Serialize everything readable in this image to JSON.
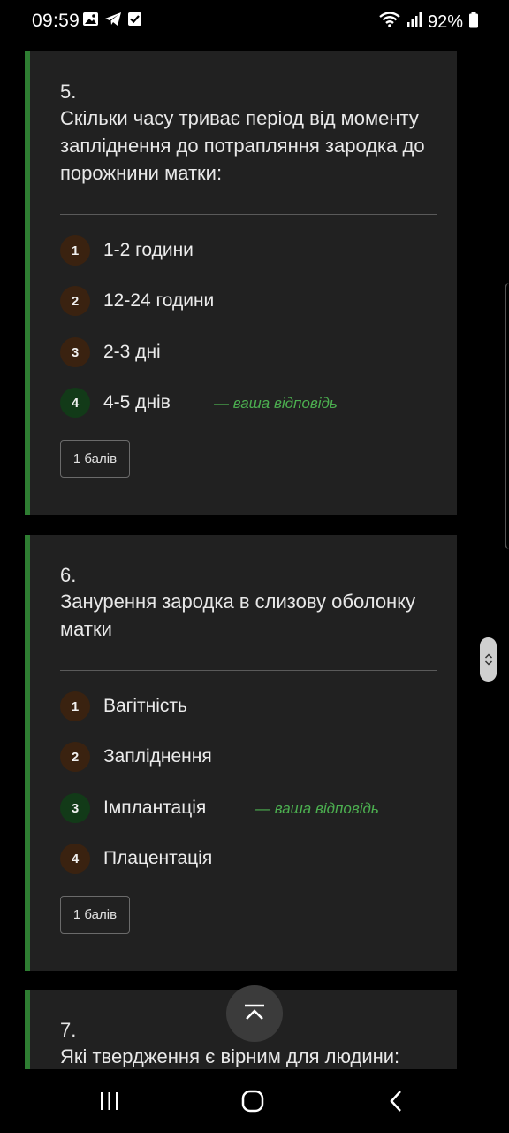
{
  "status_bar": {
    "time": "09:59",
    "battery": "92%",
    "icons_left": [
      "image-icon",
      "telegram-icon",
      "checkbox-icon"
    ],
    "icons_right": [
      "wifi-icon",
      "signal-icon",
      "battery-icon"
    ]
  },
  "questions": [
    {
      "number": "5.",
      "text": "Скільки часу триває період від моменту запліднення до потрапляння зародка до порожнини матки:",
      "options": [
        {
          "num": "1",
          "label": "1-2 години"
        },
        {
          "num": "2",
          "label": "12-24 години"
        },
        {
          "num": "3",
          "label": "2-3 дні"
        },
        {
          "num": "4",
          "label": "4-5 днів"
        }
      ],
      "your_answer_index": 3,
      "your_answer_label": "— ваша відповідь",
      "points": "1 балів"
    },
    {
      "number": "6.",
      "text": "Занурення зародка в слизову оболонку матки",
      "options": [
        {
          "num": "1",
          "label": "Вагітність"
        },
        {
          "num": "2",
          "label": "Запліднення"
        },
        {
          "num": "3",
          "label": "Імплантація"
        },
        {
          "num": "4",
          "label": "Плацентація"
        }
      ],
      "your_answer_index": 2,
      "your_answer_label": "— ваша відповідь",
      "points": "1 балів"
    },
    {
      "number": "7.",
      "text": "Які твердження є вірним для людини:"
    }
  ],
  "colors": {
    "card_bg": "#212121",
    "accent_green": "#2e7d32",
    "answer_green": "#4caf50",
    "option_badge": "#3a2210",
    "option_badge_correct": "#123a18"
  },
  "nav_bar": {
    "buttons": [
      "recents-icon",
      "home-icon",
      "back-icon"
    ]
  },
  "scroll_to_top_icon": "chevron-up-bar-icon"
}
